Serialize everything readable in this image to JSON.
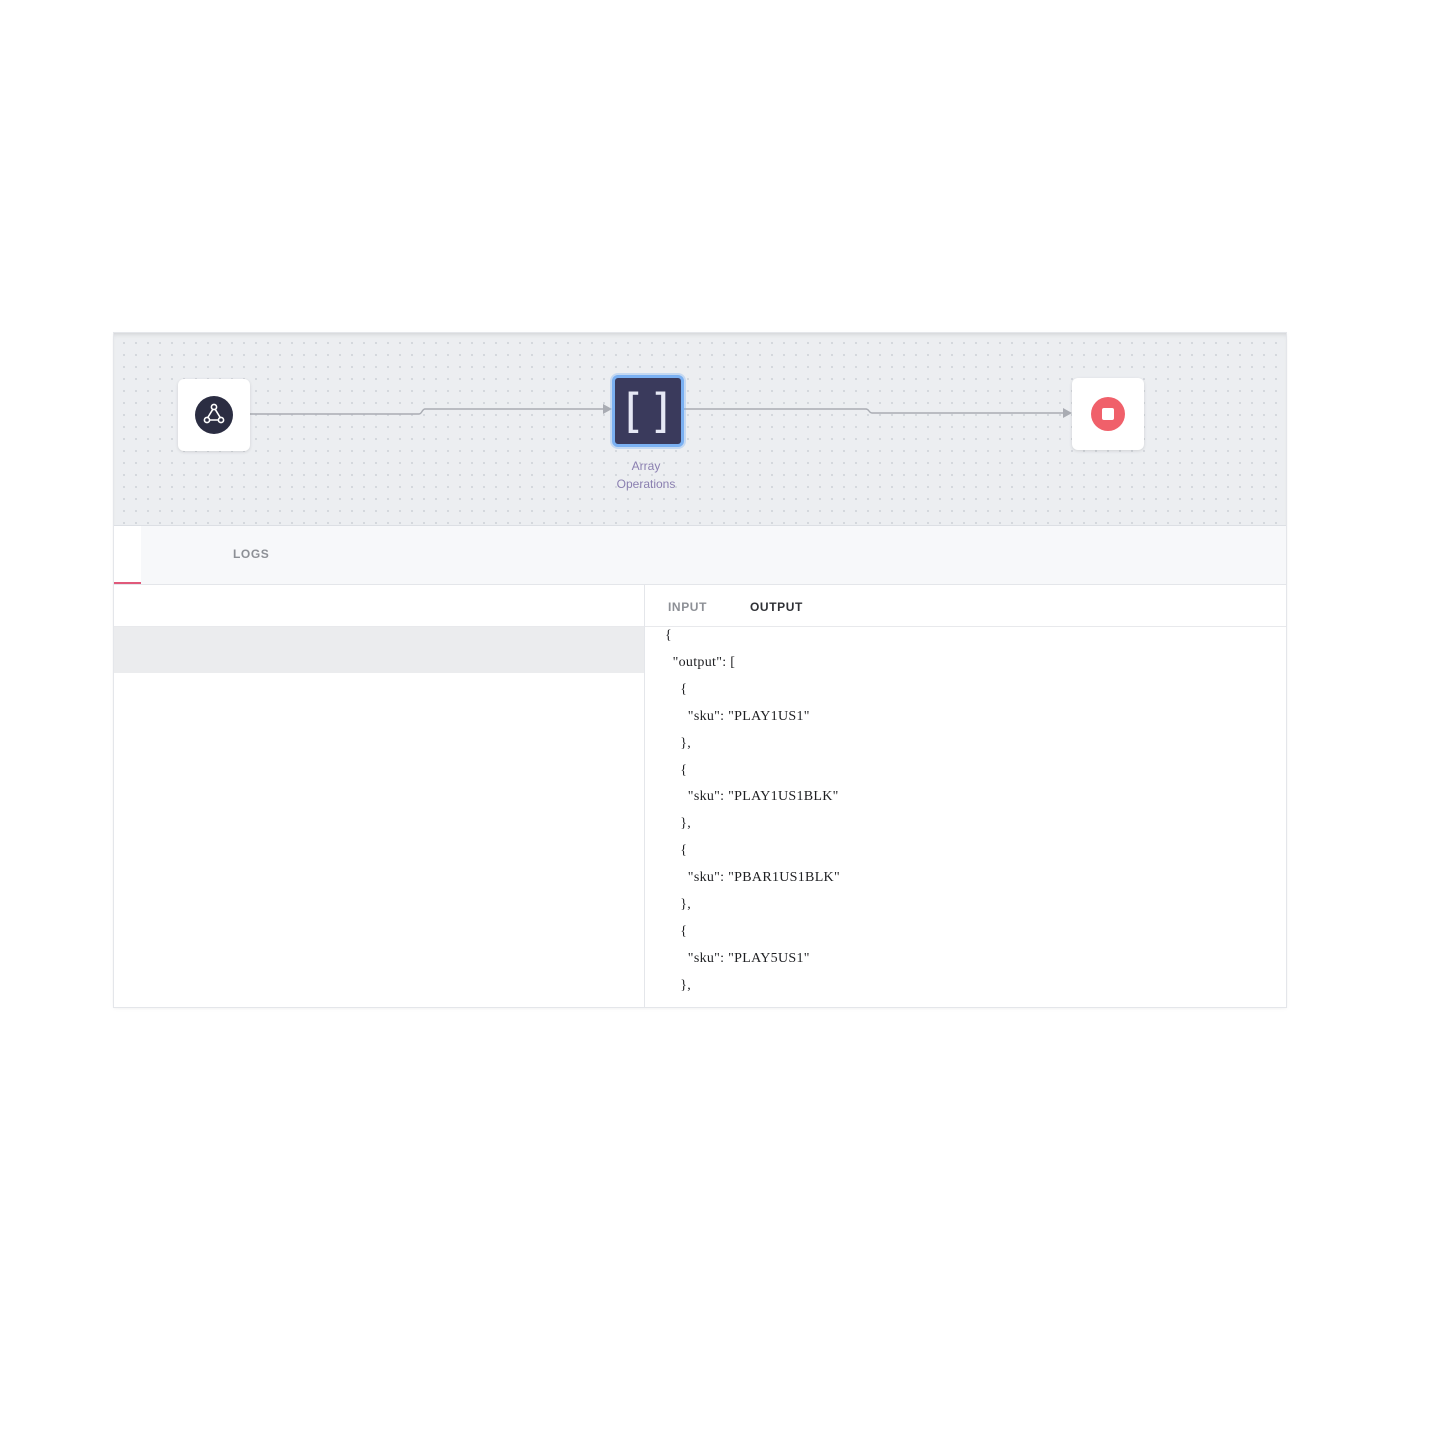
{
  "flow": {
    "nodes": [
      {
        "id": "webhook",
        "icon": "webhook-icon"
      },
      {
        "id": "array_operations",
        "icon": "brackets-icon",
        "label_line1": "Array",
        "label_line2": "Operations"
      },
      {
        "id": "stop",
        "icon": "stop-icon"
      }
    ],
    "colors": {
      "canvas_bg": "#eceef1",
      "webhook_icon": "#2b2d42",
      "array_node": "#3a3a5c",
      "array_border": "#7ab0f2",
      "stop_icon": "#f0606a",
      "active_tab_underline": "#e0597a"
    }
  },
  "tabs": {
    "logs": "LOGS"
  },
  "io": {
    "input_tab": "INPUT",
    "output_tab": "OUTPUT"
  },
  "output_json": {
    "text": "{\n  \"output\": [\n    {\n      \"sku\": \"PLAY1US1\"\n    },\n    {\n      \"sku\": \"PLAY1US1BLK\"\n    },\n    {\n      \"sku\": \"PBAR1US1BLK\"\n    },\n    {\n      \"sku\": \"PLAY5US1\"\n    },"
  }
}
